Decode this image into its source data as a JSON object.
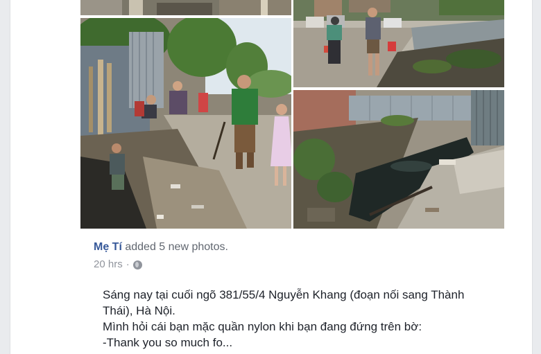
{
  "post": {
    "author": "Mẹ Tí",
    "action": "added",
    "photos_link": "5 new photos",
    "period": ".",
    "timestamp": "20 hrs",
    "separator": "·",
    "privacy_icon": "globe-icon",
    "text_lines": [
      "Sáng nay tại cuối ngõ 381/55/4 Nguyễn Khang (đoạn nối sang Thành",
      "Thái), Hà Nội.",
      "Mình hỏi cái bạn mặc quần nylon khi bạn đang đứng trên bờ:",
      "-Thank you so much fo..."
    ]
  },
  "colors": {
    "link": "#365899",
    "text": "#1d2129",
    "meta": "#90949c",
    "background": "#e9ebee",
    "card": "#ffffff"
  },
  "photos": [
    {
      "name": "photo-top-left-partial",
      "description": "partial top of photo"
    },
    {
      "name": "photo-canal-cleanup",
      "description": "people cleaning canal bank"
    },
    {
      "name": "photo-street-motorbike",
      "description": "street with motorbike and man"
    },
    {
      "name": "photo-canal-water",
      "description": "dark canal water with debris"
    },
    {
      "name": "photo-top-right-partial",
      "description": "partial top of photo"
    }
  ]
}
